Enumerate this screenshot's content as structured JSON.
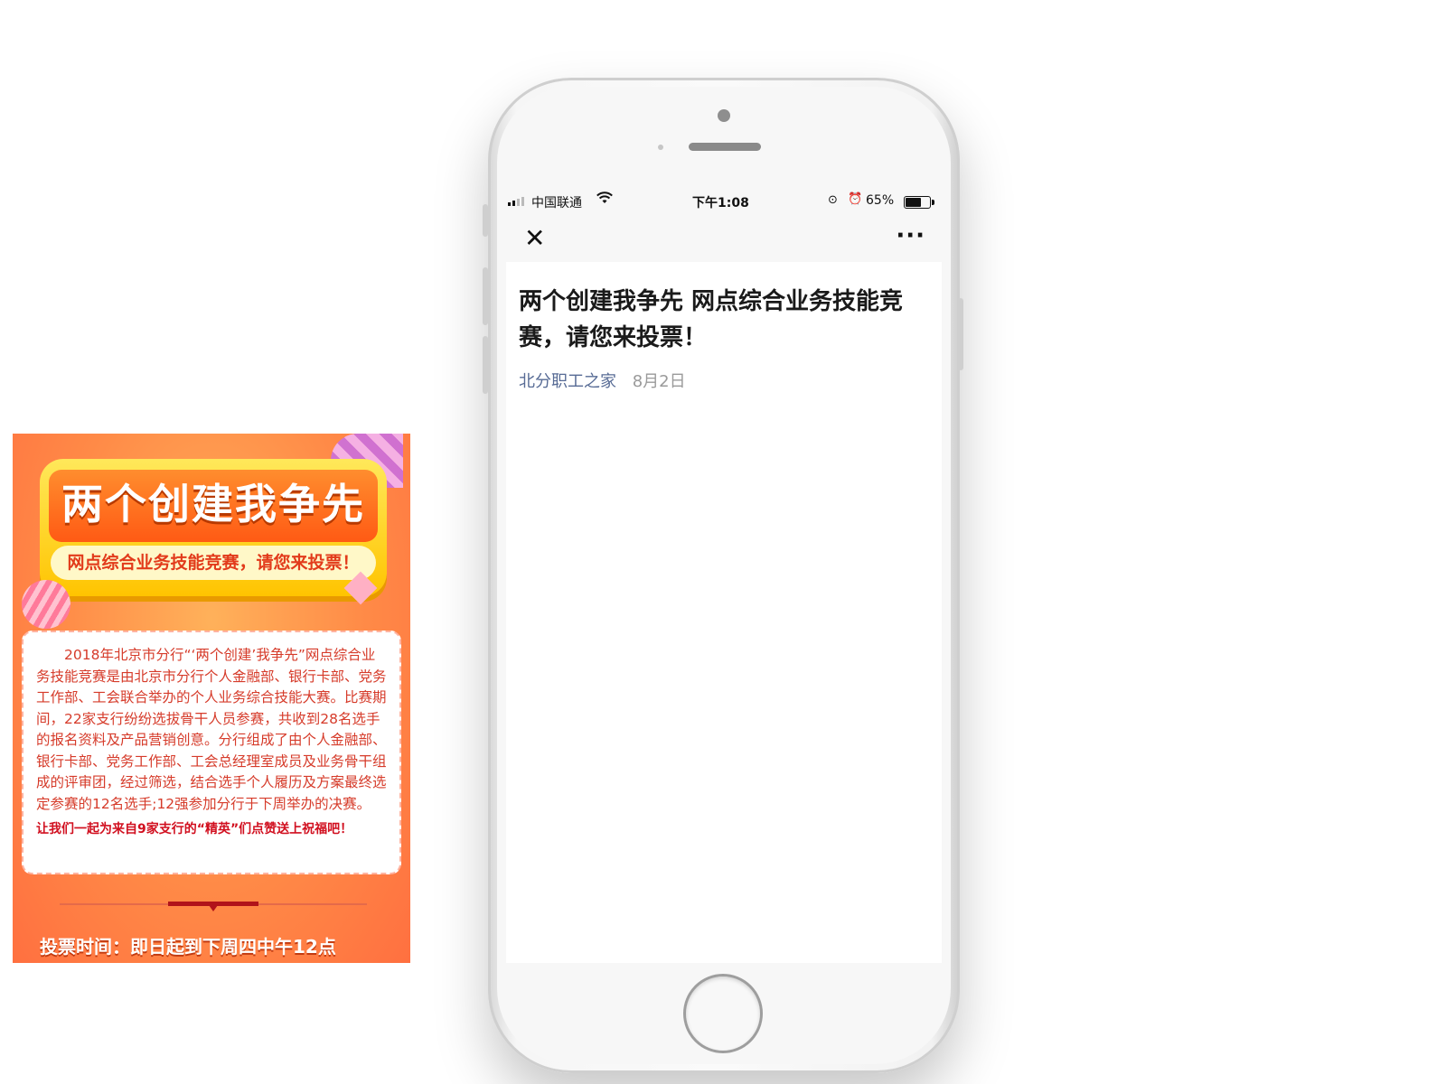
{
  "status_bar": {
    "carrier": "中国联通",
    "time": "下午1:08",
    "battery_percent": "65%",
    "battery_level": 0.65
  },
  "nav": {
    "close_icon": "close-icon",
    "more_icon": "more-icon"
  },
  "article": {
    "title": "两个创建我争先 网点综合业务技能竞赛，请您来投票！",
    "author": "北分职工之家",
    "date": "8月2日"
  },
  "poster": {
    "headline": "两个创建我争先",
    "subline": "网点综合业务技能竞赛，请您来投票！",
    "body": "2018年北京市分行“‘两个创建’我争先”网点综合业务技能竞赛是由北京市分行个人金融部、银行卡部、党务工作部、工会联合举办的个人业务综合技能大赛。比赛期间，22家支行纷纷选拔骨干人员参赛，共收到28名选手的报名资料及产品营销创意。分行组成了由个人金融部、银行卡部、党务工作部、工会总经理室成员及业务骨干组成的评审团，经过筛选，结合选手个人履历及方案最终选定参赛的12名选手;12强参加分行于下周举办的决赛。",
    "cta": "让我们一起为来自9家支行的“精英”们点赞送上祝福吧！",
    "vote_time": "投票时间：即日起到下周四中午12点"
  },
  "colors": {
    "author_link": "#576b95",
    "poster_orange": "#ff8a47",
    "poster_text_red": "#d63b2a"
  }
}
